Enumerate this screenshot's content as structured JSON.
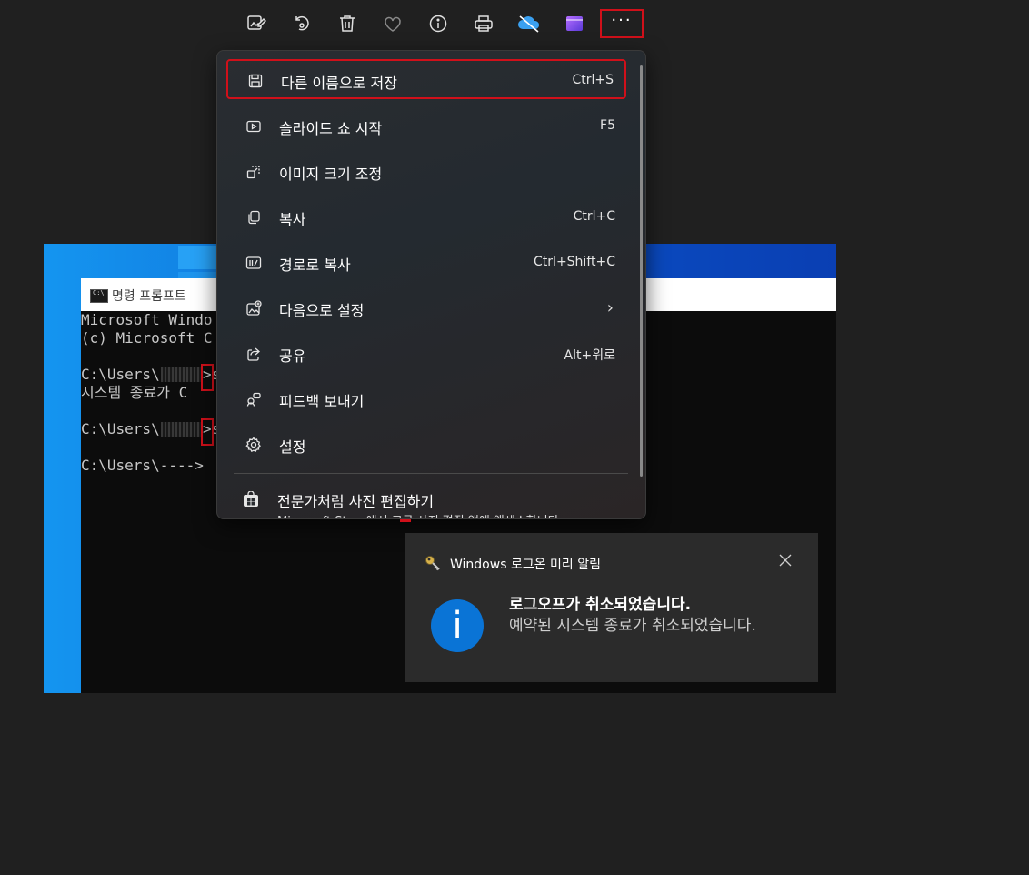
{
  "toolbar": {
    "items": [
      {
        "icon": "edit-image-icon"
      },
      {
        "icon": "rotate-icon"
      },
      {
        "icon": "delete-icon"
      },
      {
        "icon": "favorite-icon"
      },
      {
        "icon": "info-icon"
      },
      {
        "icon": "print-icon"
      },
      {
        "icon": "onedrive-off-icon"
      },
      {
        "icon": "clipchamp-icon"
      },
      {
        "icon": "more-options-icon",
        "label": "···"
      }
    ]
  },
  "menu": {
    "items": [
      {
        "label": "다른 이름으로 저장",
        "shortcut": "Ctrl+S",
        "icon": "save-icon",
        "selected": true
      },
      {
        "label": "슬라이드 쇼 시작",
        "shortcut": "F5",
        "icon": "slideshow-icon"
      },
      {
        "label": "이미지 크기 조정",
        "shortcut": "",
        "icon": "resize-icon"
      },
      {
        "label": "복사",
        "shortcut": "Ctrl+C",
        "icon": "copy-icon"
      },
      {
        "label": "경로로 복사",
        "shortcut": "Ctrl+Shift+C",
        "icon": "copy-path-icon"
      },
      {
        "label": "다음으로 설정",
        "shortcut": "",
        "icon": "set-as-icon",
        "submenu": true
      },
      {
        "label": "공유",
        "shortcut": "Alt+위로",
        "icon": "share-icon"
      },
      {
        "label": "피드백 보내기",
        "shortcut": "",
        "icon": "feedback-icon"
      },
      {
        "label": "설정",
        "shortcut": "",
        "icon": "settings-icon"
      }
    ],
    "promo": {
      "title": "전문가처럼 사진 편집하기",
      "subtitle": "Microsoft Store에서 고급 사진 편집 앱에 액세스합니다",
      "icon": "store-icon"
    }
  },
  "cmd": {
    "title": "명령 프롬프트",
    "icon_text": "C:\\",
    "lines": [
      "Microsoft Windo",
      "(c) Microsoft C",
      "",
      "C:\\Users\\",
      "시스템 종료가 C",
      "",
      "C:\\Users\\",
      "",
      "C:\\Users\\---->"
    ],
    "line_tail": ">s"
  },
  "toast": {
    "app": "Windows 로그온 미리 알림",
    "title": "로그오프가 취소되었습니다.",
    "body": "예약된 시스템 종료가 취소되었습니다.",
    "info_glyph": "i",
    "close": "×"
  },
  "colors": {
    "accent_red": "#d0101a",
    "toast_info_blue": "#0a74d6"
  }
}
